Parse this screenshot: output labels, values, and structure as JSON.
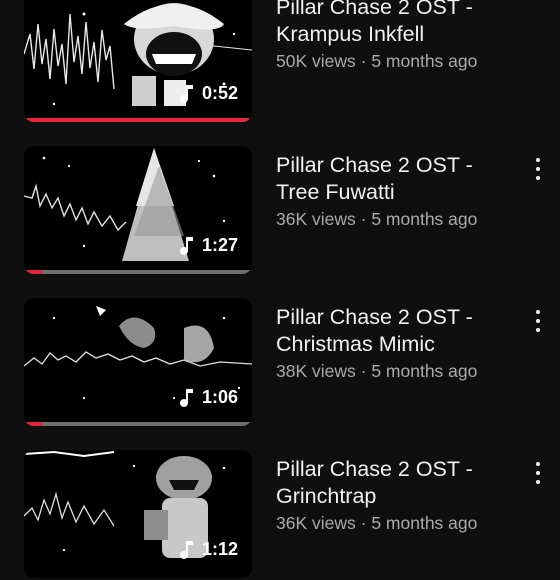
{
  "videos": [
    {
      "title_line1": "Pillar Chase 2 OST -",
      "title_line2": "Krampus Inkfell",
      "views": "50K views",
      "age": "5 months ago",
      "duration": "0:52",
      "progress": 1.0,
      "thumbnail_subject": "krampus",
      "icon": "music-note-icon"
    },
    {
      "title_line1": "Pillar Chase 2 OST -",
      "title_line2": "Tree Fuwatti",
      "views": "36K views",
      "age": "5 months ago",
      "duration": "1:27",
      "progress": 0.08,
      "thumbnail_subject": "christmas-tree",
      "icon": "music-note-icon"
    },
    {
      "title_line1": "Pillar Chase 2 OST -",
      "title_line2": "Christmas Mimic",
      "views": "38K views",
      "age": "5 months ago",
      "duration": "1:06",
      "progress": 0.08,
      "thumbnail_subject": "mimic",
      "icon": "music-note-icon"
    },
    {
      "title_line1": "Pillar Chase 2 OST -",
      "title_line2": "Grinchtrap",
      "views": "36K views",
      "age": "5 months ago",
      "duration": "1:12",
      "progress": 0.0,
      "thumbnail_subject": "grinchtrap",
      "icon": "music-note-icon"
    }
  ],
  "separator": " · ",
  "colors": {
    "background": "#0f0f0f",
    "progress_watched": "#e8263a",
    "meta_text": "#aaaaaa"
  }
}
